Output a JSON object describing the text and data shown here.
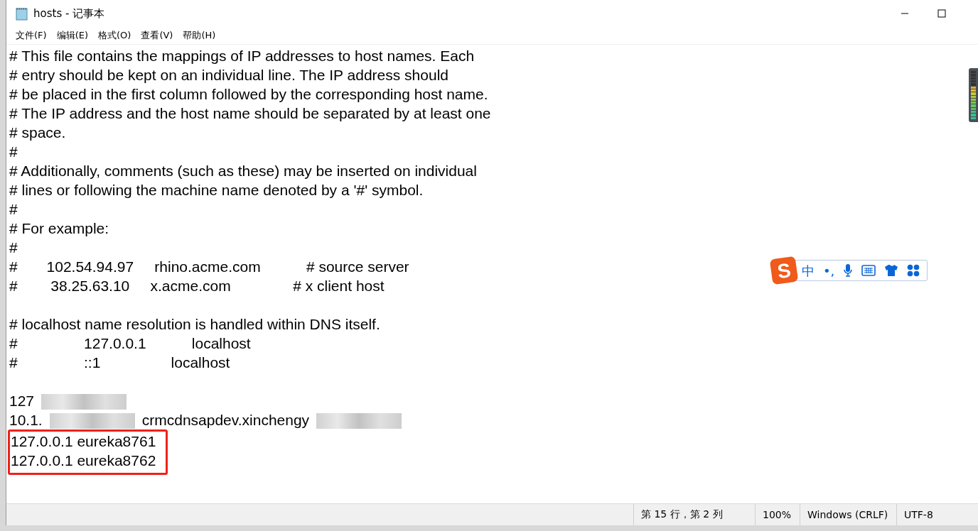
{
  "window": {
    "title": "hosts - 记事本"
  },
  "menu": [
    {
      "label": "文件(F)"
    },
    {
      "label": "编辑(E)"
    },
    {
      "label": "格式(O)"
    },
    {
      "label": "查看(V)"
    },
    {
      "label": "帮助(H)"
    }
  ],
  "editor": {
    "lines": [
      {
        "kind": "text",
        "text": "# This file contains the mappings of IP addresses to host names. Each"
      },
      {
        "kind": "text",
        "text": "# entry should be kept on an individual line. The IP address should"
      },
      {
        "kind": "text",
        "text": "# be placed in the first column followed by the corresponding host name."
      },
      {
        "kind": "text",
        "text": "# The IP address and the host name should be separated by at least one"
      },
      {
        "kind": "text",
        "text": "# space."
      },
      {
        "kind": "text",
        "text": "#"
      },
      {
        "kind": "text",
        "text": "# Additionally, comments (such as these) may be inserted on individual"
      },
      {
        "kind": "text",
        "text": "# lines or following the machine name denoted by a '#' symbol."
      },
      {
        "kind": "text",
        "text": "#"
      },
      {
        "kind": "text",
        "text": "# For example:"
      },
      {
        "kind": "text",
        "text": "#"
      },
      {
        "kind": "text",
        "text": "#       102.54.94.97     rhino.acme.com           # source server"
      },
      {
        "kind": "text",
        "text": "#        38.25.63.10     x.acme.com               # x client host"
      },
      {
        "kind": "blank"
      },
      {
        "kind": "text",
        "text": "# localhost name resolution is handled within DNS itself."
      },
      {
        "kind": "text",
        "text": "#                127.0.0.1           localhost"
      },
      {
        "kind": "text",
        "text": "#                ::1                 localhost"
      },
      {
        "kind": "blank"
      },
      {
        "kind": "redacted",
        "segments": [
          "127"
        ]
      },
      {
        "kind": "redacted",
        "segments": [
          "10.1.",
          "crmcdnsapdev.xinchengy"
        ]
      }
    ],
    "highlighted_lines": [
      "127.0.0.1 eureka8761",
      "127.0.0.1 eureka8762"
    ]
  },
  "ime_toolbar": {
    "logo": "S",
    "items": [
      {
        "kind": "text",
        "text": "中"
      },
      {
        "kind": "text",
        "text": "•,"
      },
      {
        "kind": "mic"
      },
      {
        "kind": "keyboard"
      },
      {
        "kind": "shirt"
      },
      {
        "kind": "grid"
      }
    ]
  },
  "status_bar": {
    "position": "第 15 行，第 2 列",
    "zoom": "100%",
    "line_ending": "Windows (CRLF)",
    "encoding": "UTF-8"
  }
}
